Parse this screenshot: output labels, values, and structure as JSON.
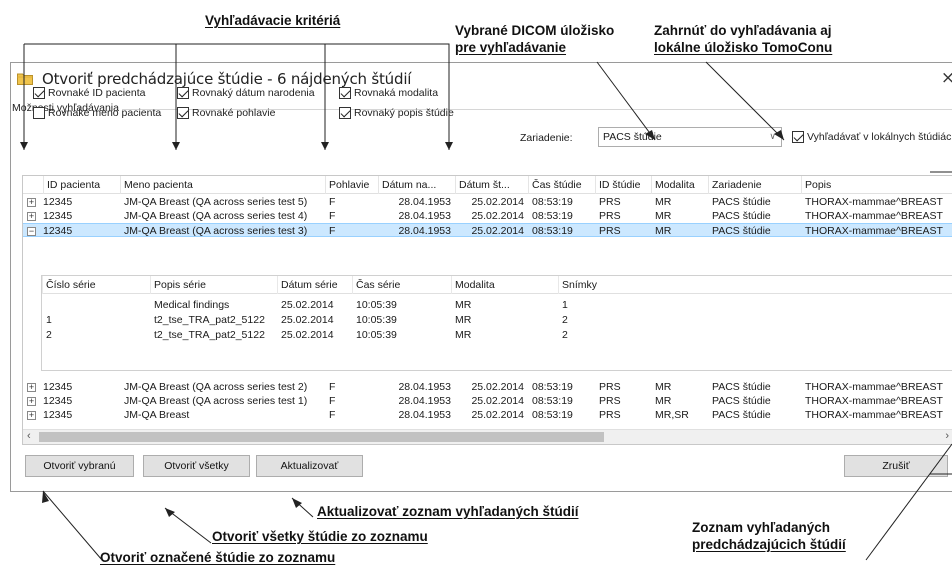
{
  "callouts": {
    "search_criteria": "Vyhľadávacie kritériá",
    "dicom_storage_line1": "Vybrané DICOM úložisko",
    "dicom_storage_line2": "pre vyhľadávanie",
    "local_storage_line1": "Zahrnúť do vyhľadávania aj",
    "local_storage_line2": "lokálne úložisko TomoConu",
    "refresh": "Aktualizovať zoznam vyhľadaných štúdií",
    "open_all": "Otvoriť všetky štúdie zo zoznamu",
    "open_selected": "Otvoriť označené štúdie zo zoznamu",
    "list_line1": "Zoznam vyhľadaných",
    "list_line2": "predchádzajúcich štúdií"
  },
  "dialog": {
    "title": "Otvoriť predchádzajúce štúdie - 6 nájdených štúdií",
    "close_symbol": "×",
    "icon": "folder-icon"
  },
  "search_options": {
    "group_title": "Možnosti vyhľadávania",
    "checkboxes": [
      {
        "label": "Rovnaké ID pacienta",
        "checked": true
      },
      {
        "label": "Rovnaký dátum narodenia",
        "checked": true
      },
      {
        "label": "Rovnaká modalita",
        "checked": true
      },
      {
        "label": "Rovnaké meno pacienta",
        "checked": false
      },
      {
        "label": "Rovnaké pohlavie",
        "checked": true
      },
      {
        "label": "Rovnaký popis štúdie",
        "checked": true
      }
    ],
    "device_label": "Zariadenie:",
    "device_value": "PACS štúdie",
    "search_local_label": "Vyhľadávať v lokálnych štúdiách",
    "search_local_checked": true
  },
  "grid": {
    "columns": [
      "ID pacienta",
      "Meno pacienta",
      "Pohlavie",
      "Dátum na...",
      "Dátum št...",
      "Čas štúdie",
      "ID štúdie",
      "Modalita",
      "Zariadenie",
      "Popis"
    ],
    "rows": [
      {
        "expander": "+",
        "id": "12345",
        "name": "JM-QA Breast (QA across series test 5)",
        "sex": "F",
        "birth": "28.04.1953",
        "date": "25.02.2014",
        "time": "08:53:19",
        "study_id": "PRS",
        "modality": "MR",
        "device": "PACS štúdie",
        "desc": "THORAX-mammae^BREAST"
      },
      {
        "expander": "+",
        "id": "12345",
        "name": "JM-QA Breast (QA across series test 4)",
        "sex": "F",
        "birth": "28.04.1953",
        "date": "25.02.2014",
        "time": "08:53:19",
        "study_id": "PRS",
        "modality": "MR",
        "device": "PACS štúdie",
        "desc": "THORAX-mammae^BREAST"
      },
      {
        "expander": "−",
        "id": "12345",
        "name": "JM-QA Breast (QA across series test 3)",
        "sex": "F",
        "birth": "28.04.1953",
        "date": "25.02.2014",
        "time": "08:53:19",
        "study_id": "PRS",
        "modality": "MR",
        "device": "PACS štúdie",
        "desc": "THORAX-mammae^BREAST"
      },
      {
        "expander": "+",
        "id": "12345",
        "name": "JM-QA Breast (QA across series test 2)",
        "sex": "F",
        "birth": "28.04.1953",
        "date": "25.02.2014",
        "time": "08:53:19",
        "study_id": "PRS",
        "modality": "MR",
        "device": "PACS štúdie",
        "desc": "THORAX-mammae^BREAST"
      },
      {
        "expander": "+",
        "id": "12345",
        "name": "JM-QA Breast (QA across series test 1)",
        "sex": "F",
        "birth": "28.04.1953",
        "date": "25.02.2014",
        "time": "08:53:19",
        "study_id": "PRS",
        "modality": "MR",
        "device": "PACS štúdie",
        "desc": "THORAX-mammae^BREAST"
      },
      {
        "expander": "+",
        "id": "12345",
        "name": "JM-QA Breast",
        "sex": "F",
        "birth": "28.04.1953",
        "date": "25.02.2014",
        "time": "08:53:19",
        "study_id": "PRS",
        "modality": "MR,SR",
        "device": "PACS štúdie",
        "desc": "THORAX-mammae^BREAST"
      }
    ],
    "series": {
      "columns": [
        "Číslo série",
        "Popis série",
        "Dátum série",
        "Čas série",
        "Modalita",
        "Snímky"
      ],
      "rows": [
        {
          "num": "",
          "desc": "Medical findings",
          "date": "25.02.2014",
          "time": "10:05:39",
          "modality": "MR",
          "images": "1"
        },
        {
          "num": "1",
          "desc": "t2_tse_TRA_pat2_5122",
          "date": "25.02.2014",
          "time": "10:05:39",
          "modality": "MR",
          "images": "2"
        },
        {
          "num": "2",
          "desc": "t2_tse_TRA_pat2_5122",
          "date": "25.02.2014",
          "time": "10:05:39",
          "modality": "MR",
          "images": "2"
        }
      ]
    }
  },
  "buttons": {
    "open_selected": "Otvoriť vybranú",
    "open_all": "Otvoriť všetky",
    "refresh": "Aktualizovať",
    "cancel": "Zrušiť"
  }
}
